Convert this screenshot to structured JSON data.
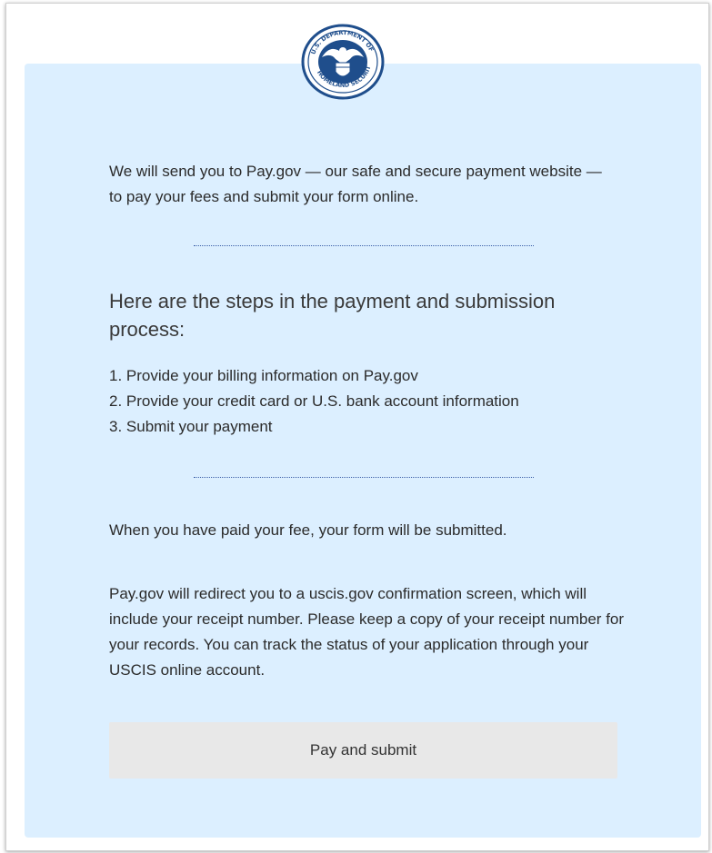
{
  "intro_text": "We will send you to Pay.gov — our safe and secure payment website — to pay your fees and submit your form online.",
  "steps": {
    "heading": "Here are the steps in the payment and submission process:",
    "items": [
      "1. Provide your billing information on Pay.gov",
      "2. Provide your credit card or U.S. bank account information",
      "3. Submit your payment"
    ]
  },
  "paid_text": "When you have paid your fee, your form will be submitted.",
  "redirect_text": "Pay.gov will redirect you to a uscis.gov confirmation screen, which will include your receipt number. Please keep a copy of your receipt number for your records. You can track the status of your application through your USCIS online account.",
  "button": {
    "label": "Pay and submit"
  },
  "seal": {
    "icon": "dhs-seal-icon",
    "text": "U.S. DEPARTMENT OF HOMELAND SECURITY"
  },
  "colors": {
    "panel": "#dcefff",
    "seal": "#1f4e8c",
    "divider": "#3b5fa8",
    "button": "#e8e8e8"
  }
}
